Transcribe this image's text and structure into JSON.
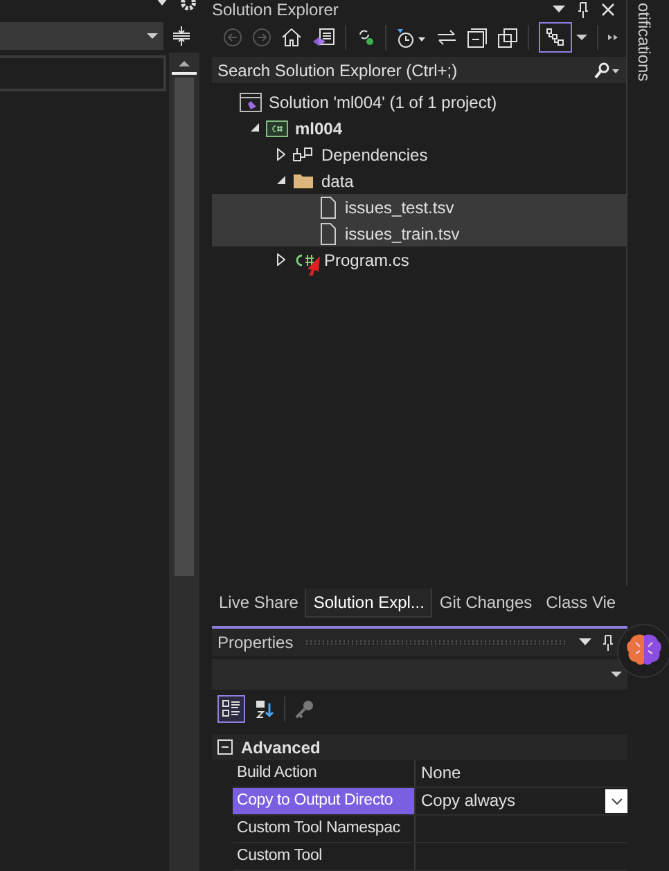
{
  "solution_explorer": {
    "title": "Solution Explorer",
    "toolbar": [
      {
        "kind": "back",
        "disabled": true
      },
      {
        "kind": "forward",
        "disabled": true
      },
      {
        "kind": "home",
        "disabled": false
      },
      {
        "kind": "switch",
        "disabled": false
      },
      {
        "kind": "sync",
        "disabled": false
      },
      {
        "kind": "history",
        "disabled": false
      },
      {
        "kind": "pending",
        "disabled": false
      },
      {
        "kind": "collapse",
        "disabled": false
      },
      {
        "kind": "copy",
        "disabled": false
      },
      {
        "kind": "view",
        "disabled": false
      }
    ],
    "search": {
      "placeholder": "Search Solution Explorer (Ctrl+;)"
    },
    "tree": [
      {
        "label": "Solution 'ml004' (1 of 1 project)",
        "kind": "solution",
        "selected": false,
        "children": [
          {
            "label": "ml004",
            "kind": "csproj",
            "bold": true,
            "expanded": true,
            "selected": false,
            "children": [
              {
                "label": "Dependencies",
                "kind": "deps",
                "expanded": false,
                "selected": false
              },
              {
                "label": "data",
                "kind": "folder",
                "expanded": true,
                "selected": false,
                "children": [
                  {
                    "label": "issues_test.tsv",
                    "kind": "file",
                    "selected": true
                  },
                  {
                    "label": "issues_train.tsv",
                    "kind": "file",
                    "selected": true
                  }
                ]
              },
              {
                "label": "Program.cs",
                "kind": "cs",
                "expanded": false,
                "selected": false
              }
            ]
          }
        ]
      }
    ]
  },
  "tabs": [
    {
      "label": "Live Share",
      "selected": false
    },
    {
      "label": "Solution Expl...",
      "selected": true
    },
    {
      "label": "Git Changes",
      "selected": false
    },
    {
      "label": "Class Vie",
      "selected": false
    }
  ],
  "properties": {
    "title": "Properties",
    "toolbar": [
      {
        "kind": "categorized",
        "selected": true
      },
      {
        "kind": "alphabetical",
        "selected": false
      },
      {
        "kind": "pages",
        "selected": false
      }
    ],
    "category": {
      "label": "Advanced",
      "expanded": true
    },
    "rows": [
      {
        "name": "Build Action",
        "value": "None",
        "selected": false
      },
      {
        "name": "Copy to Output Directo",
        "value": "Copy always",
        "selected": true
      },
      {
        "name": "Custom Tool Namespac",
        "selected": false
      },
      {
        "name": "Custom Tool",
        "selected": false
      }
    ]
  },
  "side_strip": {
    "label": "otifications"
  }
}
